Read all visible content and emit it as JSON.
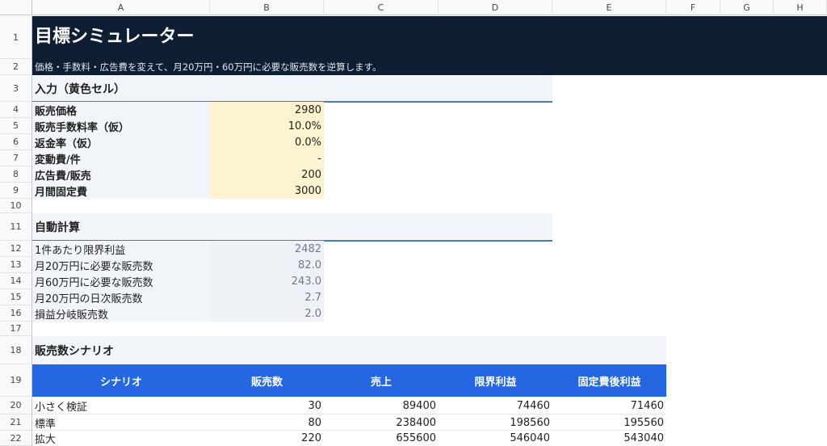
{
  "columns": [
    "A",
    "B",
    "C",
    "D",
    "E",
    "F",
    "G",
    "H"
  ],
  "rows": [
    "1",
    "2",
    "3",
    "4",
    "5",
    "6",
    "7",
    "8",
    "9",
    "10",
    "11",
    "12",
    "13",
    "14",
    "15",
    "16",
    "17",
    "18",
    "19",
    "20",
    "21",
    "22"
  ],
  "title": "目標シミュレーター",
  "subtitle": "価格・手数料・広告費を変えて、月20万円・60万円に必要な販売数を逆算します。",
  "input_section": {
    "title": "入力（黄色セル）",
    "rows": [
      {
        "label": "販売価格",
        "value": "2980"
      },
      {
        "label": "販売手数料率（仮）",
        "value": "10.0%"
      },
      {
        "label": "返金率（仮）",
        "value": "0.0%"
      },
      {
        "label": "変動費/件",
        "value": "-"
      },
      {
        "label": "広告費/販売",
        "value": "200"
      },
      {
        "label": "月間固定費",
        "value": "3000"
      }
    ]
  },
  "calc_section": {
    "title": "自動計算",
    "rows": [
      {
        "label": "1件あたり限界利益",
        "value": "2482"
      },
      {
        "label": "月20万円に必要な販売数",
        "value": "82.0"
      },
      {
        "label": "月60万円に必要な販売数",
        "value": "243.0"
      },
      {
        "label": "月20万円の日次販売数",
        "value": "2.7"
      },
      {
        "label": "損益分岐販売数",
        "value": "2.0"
      }
    ]
  },
  "scenario_section": {
    "title": "販売数シナリオ",
    "headers": [
      "シナリオ",
      "販売数",
      "売上",
      "限界利益",
      "固定費後利益"
    ],
    "rows": [
      {
        "name": "小さく検証",
        "qty": "30",
        "sales": "89400",
        "margin": "74460",
        "profit": "71460"
      },
      {
        "name": "標準",
        "qty": "80",
        "sales": "238400",
        "margin": "198560",
        "profit": "195560"
      },
      {
        "name": "拡大",
        "qty": "220",
        "sales": "655600",
        "margin": "546040",
        "profit": "543040"
      }
    ]
  },
  "colors": {
    "title_bg": "#0e1f33",
    "section_bg": "#f1f5fa",
    "input_bg": "#fdf3d0",
    "table_header_bg": "#2467e0",
    "section_underline": "#4a78c8"
  }
}
